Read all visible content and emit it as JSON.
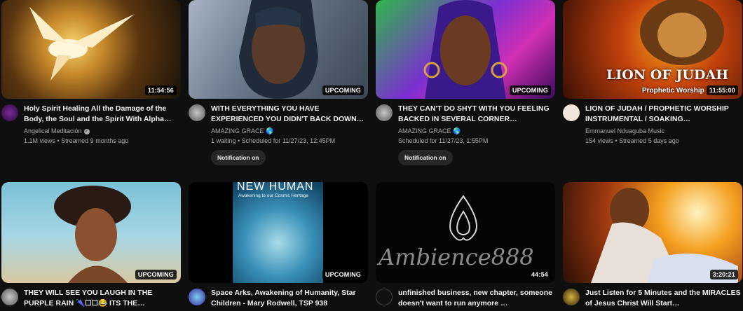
{
  "videos": [
    {
      "title": "Holy Spirit Healing All the Damage of the Body, the Soul and the Spirit With Alpha…",
      "channel": "Angelical Meditación",
      "verified_icon": "verified-check-icon",
      "stats": "1.1M views • Streamed 9 months ago",
      "badge": "11:54:56"
    },
    {
      "title": "WITH EVERYTHING YOU HAVE EXPERIENCED YOU DIDN'T BACK DOWN…",
      "channel": "AMAZING GRACE 🌎",
      "stats": "1 waiting • Scheduled for 11/27/23, 12:45PM",
      "badge": "UPCOMING",
      "notify_label": "Notification on"
    },
    {
      "title": "THEY CAN'T DO SHYT WITH YOU FEELING BACKED IN SEVERAL CORNER…",
      "channel": "AMAZING GRACE 🌎",
      "stats": "Scheduled for 11/27/23, 1:55PM",
      "badge": "UPCOMING",
      "notify_label": "Notification on"
    },
    {
      "title": "LION OF JUDAH / PROPHETIC WORSHIP INSTRUMENTAL / SOAKING…",
      "channel": "Emmanuel Nduaguba Music",
      "stats": "154 views • Streamed 5 days ago",
      "badge": "11:55:00",
      "thumb_text": "LION OF JUDAH",
      "thumb_subtext": "Prophetic Worship"
    },
    {
      "title": "THEY WILL SEE YOU LAUGH IN THE PURPLE RAIN 🌂☐☐😂 ITS THE…",
      "badge": "UPCOMING"
    },
    {
      "title": "Space Arks, Awakening of Humanity, Star Children - Mary Rodwell, TSP 938",
      "badge": "UPCOMING",
      "thumb_text": "NEW HUMAN",
      "thumb_subtext": "Awakening to our Cosmic Heritage"
    },
    {
      "title": "unfinished business, new chapter, someone doesn't want to run anymore …",
      "badge": "44:54",
      "thumb_text": "Ambience888"
    },
    {
      "title": "Just Listen for 5 Minutes and the MIRACLES of Jesus Christ Will Start…",
      "badge": "3:20:21"
    }
  ]
}
